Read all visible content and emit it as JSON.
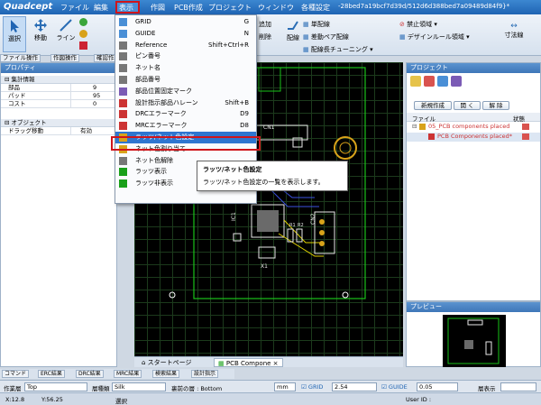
{
  "app": {
    "logo": "Quadcept",
    "window_title": "-28bed7a19bcf7d39d/512d6d388bed7a09489d84f9}*"
  },
  "menu": [
    "ファイル",
    "編集",
    "表示",
    "作図",
    "PCB作成",
    "プロジェクト",
    "ウィンドウ",
    "各種設定"
  ],
  "ribbon": {
    "select": "選択",
    "move": "移動",
    "line": "ライン",
    "add": "追加",
    "delete": "削除",
    "route": "配線",
    "diff_pair": "差動ペア配線",
    "single": "単配線",
    "tuning": "配線長チューニング",
    "prohibit": "禁止領域",
    "design_rule": "デザインルール領域",
    "dim": "寸法線"
  },
  "left_tabs": [
    "ファイル操作",
    "作図操作",
    "確認作業"
  ],
  "properties": {
    "title": "プロパティ",
    "group1": "集計情報",
    "rows1": [
      {
        "k": "部品",
        "v": "9"
      },
      {
        "k": "パッド",
        "v": "95"
      },
      {
        "k": "コスト",
        "v": "0"
      }
    ],
    "group2": "オブジェクト",
    "rows2": [
      {
        "k": "ドラッグ移動",
        "v": "有効"
      }
    ]
  },
  "view_menu": {
    "items": [
      {
        "label": "GRID",
        "shortcut": "G",
        "icon": "grid-icon"
      },
      {
        "label": "GUIDE",
        "shortcut": "N",
        "icon": "guide-icon"
      },
      {
        "label": "Reference",
        "shortcut": "Shift+Ctrl+R",
        "icon": "reference-icon"
      },
      {
        "label": "ピン番号",
        "shortcut": "",
        "icon": "pin-number-icon"
      },
      {
        "label": "ネット名",
        "shortcut": "",
        "icon": "net-name-icon"
      },
      {
        "label": "部品番号",
        "shortcut": "",
        "icon": "part-number-icon"
      },
      {
        "label": "部品位置固定マーク",
        "shortcut": "",
        "icon": "lock-mark-icon"
      },
      {
        "label": "設計指示部品ハレーン",
        "shortcut": "Shift+B",
        "icon": "design-instruction-icon"
      },
      {
        "label": "DRCエラーマーク",
        "shortcut": "D9",
        "icon": "drc-error-icon"
      },
      {
        "label": "MRCエラーマーク",
        "shortcut": "D8",
        "icon": "mrc-error-icon"
      },
      {
        "label": "ラッツ/ネット色設定",
        "shortcut": "",
        "icon": "ratsnest-color-icon"
      },
      {
        "label": "ネット色割り当て",
        "shortcut": "",
        "icon": "net-color-assign-icon"
      },
      {
        "label": "ネット色解除",
        "shortcut": "",
        "icon": "net-color-clear-icon"
      },
      {
        "label": "ラッツ表示",
        "shortcut": "",
        "icon": "ratsnest-show-icon"
      },
      {
        "label": "ラッツ非表示",
        "shortcut": "",
        "icon": "ratsnest-hide-icon"
      }
    ]
  },
  "tooltip": {
    "title": "ラッツ/ネット色設定",
    "desc": "ラッツ/ネット色設定の一覧を表示します。"
  },
  "project": {
    "title": "プロジェクト",
    "new_btn": "新規作成",
    "open_btn": "開 く",
    "remove_btn": "解 除",
    "col_file": "ファイル",
    "col_status": "状態",
    "items": [
      "05_PCB components placed",
      "PCB Components placed*"
    ]
  },
  "preview": {
    "title": "プレビュー"
  },
  "doc_tabs": [
    "スタートページ",
    "PCB Compone"
  ],
  "bottom_tabs": [
    "コマンド",
    "ERC結果",
    "DRC結果",
    "MRC結果",
    "検索結果",
    "設計指示"
  ],
  "layer_bar": {
    "layer_label": "作業層",
    "layer": "Top",
    "type_label": "層種類",
    "type": "Silk",
    "face_label": "裏前の層 : Bottom",
    "unit": "mm",
    "grid_label": "GRID",
    "grid": "2.54",
    "guide_label": "GUIDE",
    "guide": "0.05",
    "comp_label": "層表示"
  },
  "status": {
    "x": "X:12.8",
    "y": "Y:56.25",
    "mode": "選択",
    "user": "User ID :"
  },
  "canvas_labels": {
    "cn1": "CN1",
    "ic1": "IC1",
    "cn2": "CN2",
    "r1": "R1",
    "r2": "R2",
    "r3": "R3",
    "x1": "X1"
  },
  "colors": {
    "accent": "#1f64b3",
    "highlight": "#d0151b",
    "pcb_outline": "#19c219",
    "silk": "#e8e8e8",
    "trace": "#e0d000"
  }
}
